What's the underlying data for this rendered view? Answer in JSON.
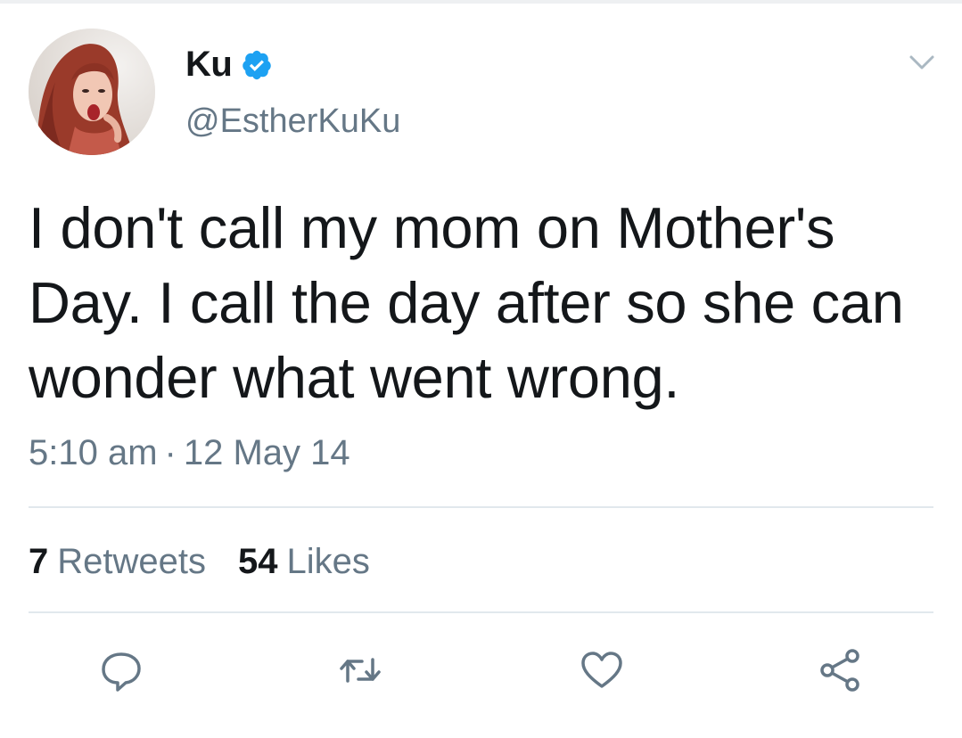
{
  "tweet": {
    "author": {
      "display_name": "Ku",
      "handle": "@EstherKuKu",
      "verified": true,
      "avatar_icon": "profile-photo"
    },
    "text": "I don't call my mom on Mother's Day. I call the day after so she can wonder what went wrong.",
    "time": "5:10 am",
    "separator": "·",
    "date": "12 May 14",
    "retweets": {
      "count": "7",
      "label": "Retweets"
    },
    "likes": {
      "count": "54",
      "label": "Likes"
    }
  },
  "actions": {
    "reply": {
      "icon": "reply-bubble-icon"
    },
    "retweet": {
      "icon": "retweet-arrows-icon"
    },
    "like": {
      "icon": "heart-icon"
    },
    "share": {
      "icon": "share-nodes-icon"
    }
  },
  "menu": {
    "icon": "chevron-down-icon"
  },
  "colors": {
    "primary_text": "#14171a",
    "secondary_text": "#657786",
    "verified_blue": "#1da1f2",
    "divider": "#e1e8ed",
    "icon_gray": "#657786"
  }
}
